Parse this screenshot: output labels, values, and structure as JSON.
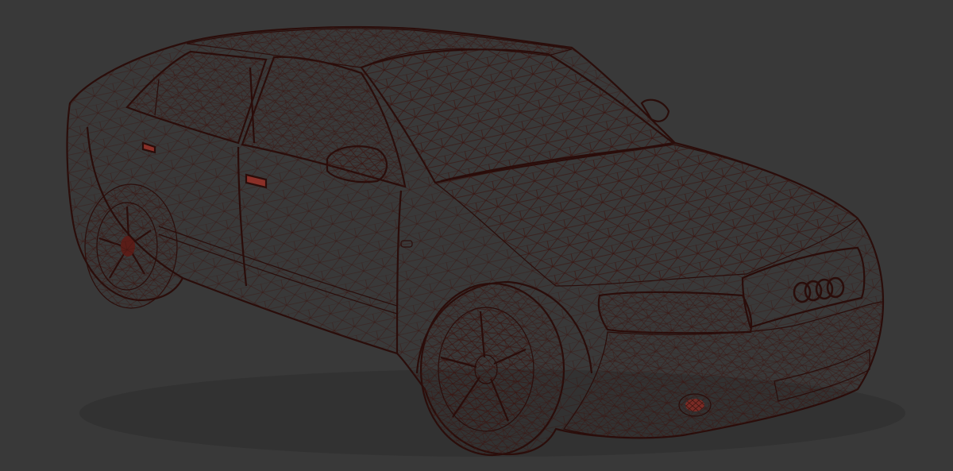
{
  "viewport": {
    "background": "#393939",
    "render_mode": "wireframe-on-shaded"
  },
  "model": {
    "subject": "sedan-car",
    "body_color": "#c0564d",
    "body_highlight": "#d8766b",
    "body_shadow": "#8c332c",
    "wire_color": "#3a1410",
    "tire_color": "#5a1d18"
  },
  "icons": {
    "brand_logo": "four-rings-logo"
  }
}
